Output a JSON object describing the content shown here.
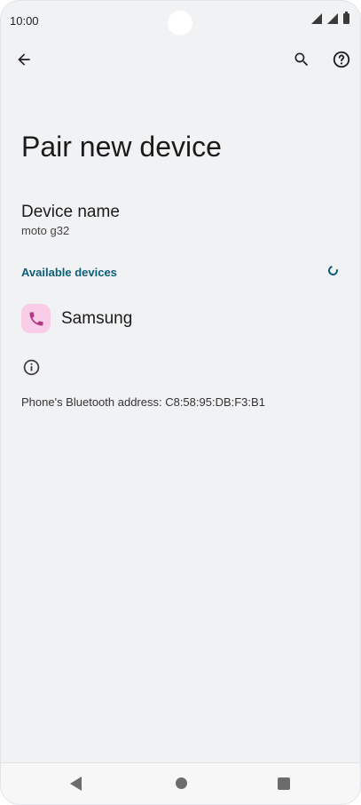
{
  "status_bar": {
    "time": "10:00"
  },
  "toolbar": {
    "back_icon": "arrow-left-icon",
    "search_icon": "search-icon",
    "help_icon": "help-circle-icon"
  },
  "page": {
    "title": "Pair new device",
    "device_name_label": "Device name",
    "device_name_value": "moto g32",
    "available_devices_header": "Available devices",
    "devices": [
      {
        "label": "Samsung",
        "icon": "phone-icon",
        "icon_bg": "#f9cce8",
        "icon_color": "#b23a84"
      }
    ],
    "bluetooth_address": "Phone's Bluetooth address: C8:58:95:DB:F3:B1"
  },
  "colors": {
    "accent": "#0b5e7a",
    "background": "#f1f2f4"
  }
}
